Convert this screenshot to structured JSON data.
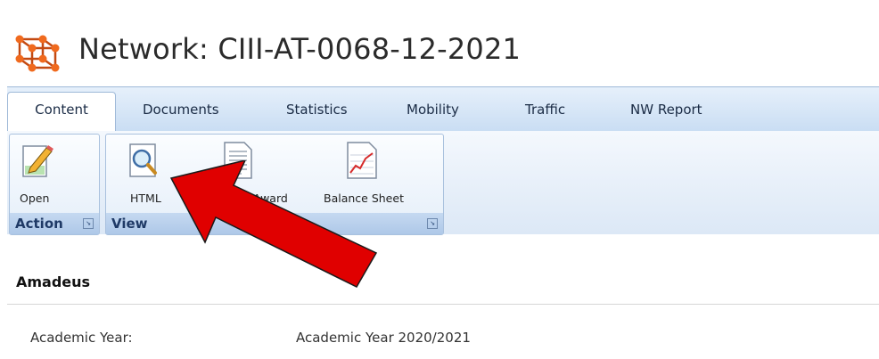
{
  "page": {
    "title": "Network: CIII-AT-0068-12-2021"
  },
  "tabs": [
    {
      "label": "Content",
      "active": true
    },
    {
      "label": "Documents"
    },
    {
      "label": "Statistics"
    },
    {
      "label": "Mobility"
    },
    {
      "label": "Traffic"
    },
    {
      "label": "NW Report"
    }
  ],
  "ribbon": {
    "groups": {
      "action": {
        "label": "Action",
        "buttons": [
          {
            "label": "Open",
            "icon": "edit-document-icon"
          }
        ]
      },
      "view": {
        "label": "View",
        "buttons": [
          {
            "label": "HTML",
            "icon": "magnifier-document-icon"
          },
          {
            "label": "of Award",
            "icon": "text-document-icon"
          },
          {
            "label": "Balance Sheet",
            "icon": "chart-document-icon"
          }
        ]
      }
    }
  },
  "section": {
    "title": "Amadeus",
    "fields": [
      {
        "label": "Academic Year:",
        "value": "Academic Year 2020/2021"
      }
    ]
  },
  "annotation": {
    "icon": "red-arrow",
    "color": "#e00000"
  },
  "colors": {
    "accent": "#1f3a66",
    "tab_bg": "#c9ddf3",
    "icon_orange": "#e8651e"
  }
}
